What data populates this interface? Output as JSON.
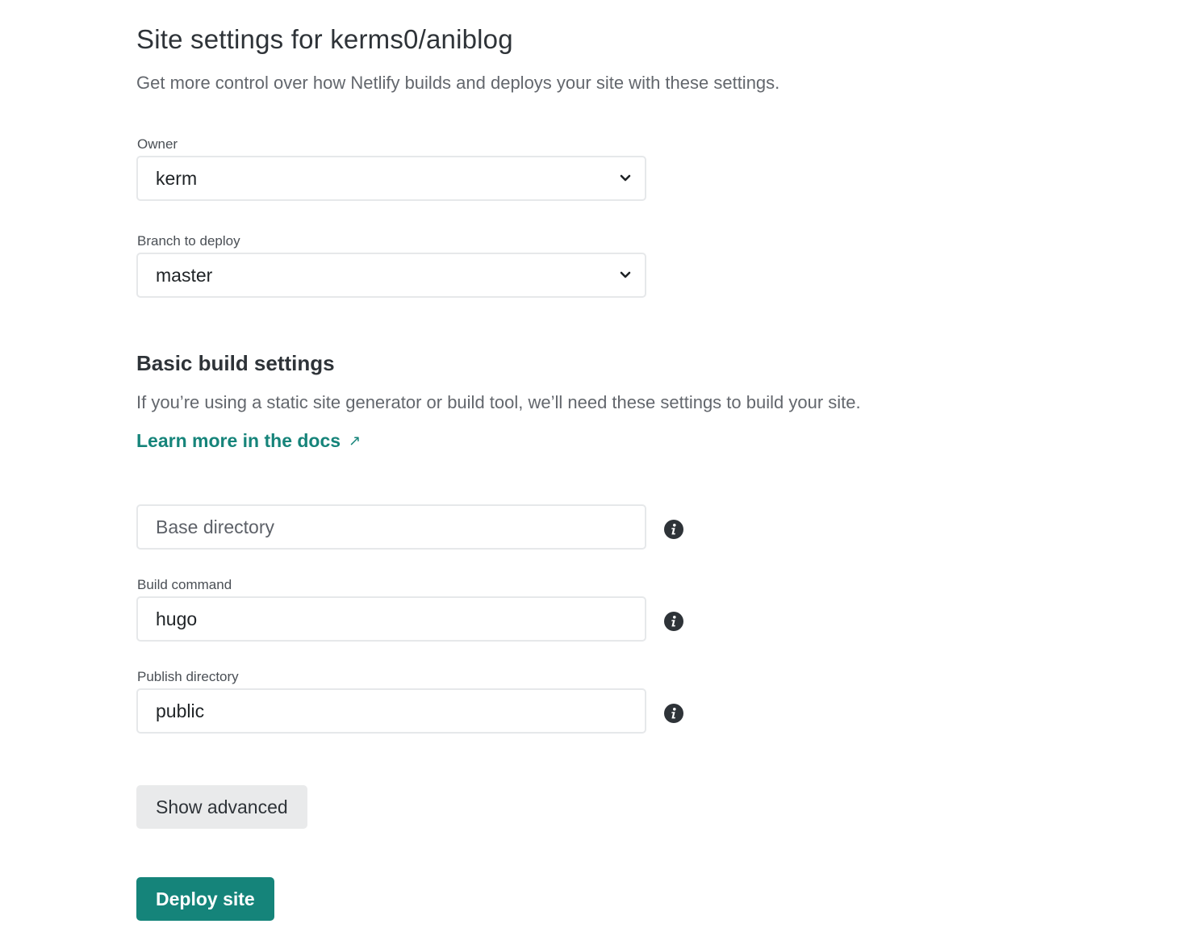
{
  "header": {
    "title": "Site settings for kerms0/aniblog",
    "subtitle": "Get more control over how Netlify builds and deploys your site with these settings."
  },
  "owner": {
    "label": "Owner",
    "selected": "kerm"
  },
  "branch": {
    "label": "Branch to deploy",
    "selected": "master"
  },
  "build_settings": {
    "title": "Basic build settings",
    "description": "If you’re using a static site generator or build tool, we’ll need these settings to build your site.",
    "docs_link": "Learn more in the docs",
    "docs_link_arrow": "↗"
  },
  "base_directory": {
    "placeholder": "Base directory"
  },
  "build_command": {
    "label": "Build command",
    "value": "hugo"
  },
  "publish_directory": {
    "label": "Publish directory",
    "value": "public"
  },
  "buttons": {
    "show_advanced": "Show advanced",
    "deploy": "Deploy site"
  },
  "colors": {
    "accent": "#15847a",
    "text": "#2e3338",
    "muted": "#63676d",
    "border": "#e6e8ea",
    "secondary_button": "#e9eaeb",
    "info_icon": "#2e3338"
  },
  "icons": {
    "select_chevron": "chevron-down-icon",
    "info": "info-icon",
    "external_link": "external-link-arrow-icon"
  }
}
